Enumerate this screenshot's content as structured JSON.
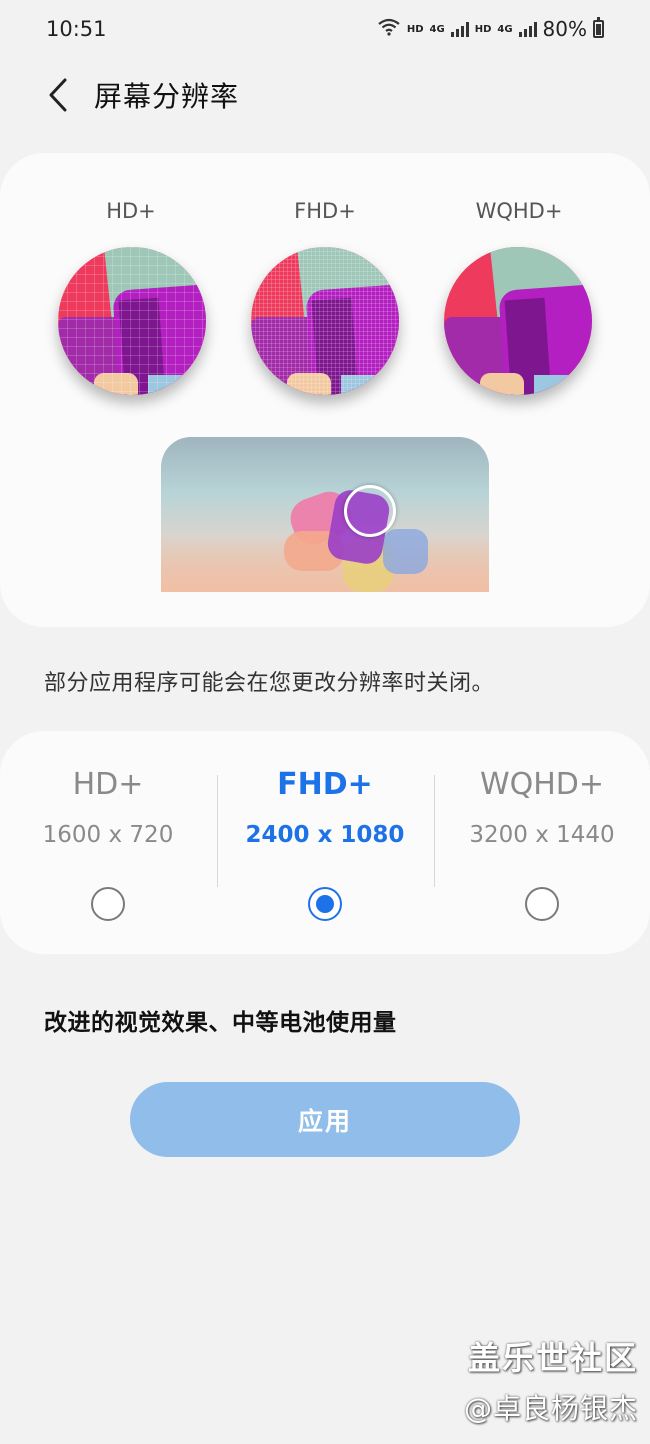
{
  "status_bar": {
    "time": "10:51",
    "hd1": "HD",
    "net1": "4G",
    "hd2": "HD",
    "net2": "4G",
    "battery": "80%"
  },
  "header": {
    "title": "屏幕分辨率"
  },
  "preview": {
    "labels": [
      "HD+",
      "FHD+",
      "WQHD+"
    ]
  },
  "info_text": "部分应用程序可能会在您更改分辨率时关闭。",
  "options": [
    {
      "name": "HD+",
      "resolution": "1600 x 720",
      "selected": false
    },
    {
      "name": "FHD+",
      "resolution": "2400 x 1080",
      "selected": true
    },
    {
      "name": "WQHD+",
      "resolution": "3200 x 1440",
      "selected": false
    }
  ],
  "description": "改进的视觉效果、中等电池使用量",
  "apply_button": "应用",
  "watermark": {
    "line1": "盖乐世社区",
    "line2": "@卓良杨银杰"
  },
  "colors": {
    "accent": "#1e72e8",
    "apply_button_bg": "#90bde9",
    "background": "#f2f2f2",
    "card": "#fbfbfb"
  }
}
